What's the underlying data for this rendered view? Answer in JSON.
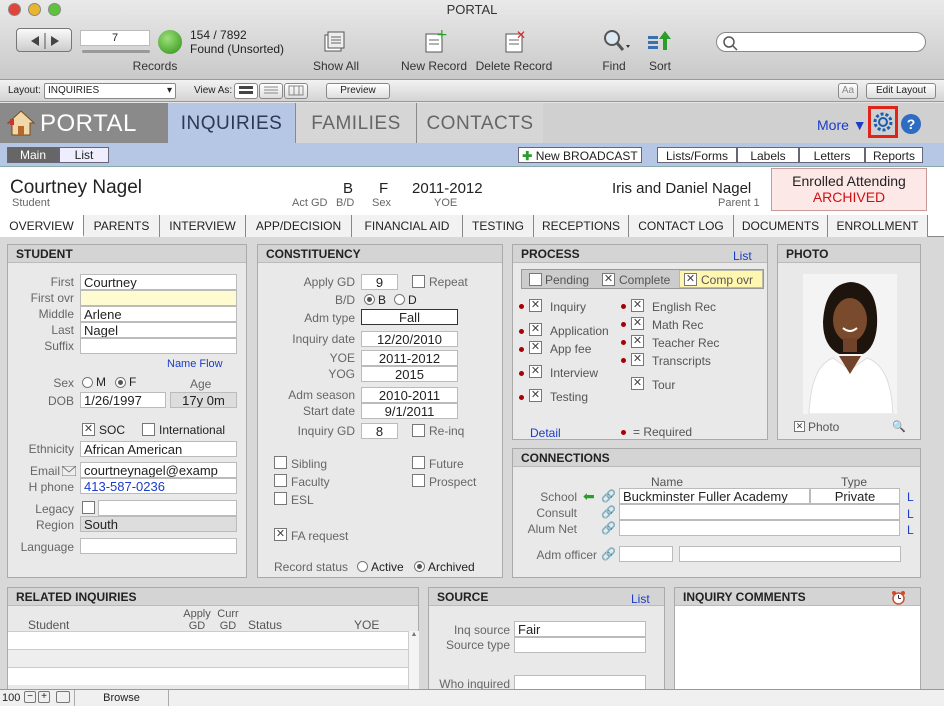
{
  "window": {
    "title": "PORTAL"
  },
  "toolbar": {
    "record_number": "7",
    "records_label": "Records",
    "count": "154 / 7892",
    "found": "Found (Unsorted)",
    "show_all": "Show All",
    "new_record": "New Record",
    "delete_record": "Delete Record",
    "find": "Find",
    "sort": "Sort"
  },
  "layoutbar": {
    "layout_label": "Layout:",
    "layout_value": "INQUIRIES",
    "view_as": "View As:",
    "preview": "Preview",
    "aa": "Aa",
    "edit_layout": "Edit Layout"
  },
  "nav": {
    "app": "PORTAL",
    "tabs": [
      "INQUIRIES",
      "FAMILIES",
      "CONTACTS"
    ],
    "more": "More"
  },
  "subbar": {
    "main": "Main",
    "list": "List",
    "new_broadcast": "New BROADCAST",
    "buttons": [
      "Lists/Forms",
      "Labels",
      "Letters",
      "Reports"
    ]
  },
  "person": {
    "name": "Courtney Nagel",
    "name_sub": "Student",
    "gd": "B",
    "gd_label": "Act GD",
    "bd_label": "B/D",
    "sex": "F",
    "sex_label": "Sex",
    "yoe": "2011-2012",
    "yoe_label": "YOE",
    "parents": "Iris and Daniel Nagel",
    "parent_label": "Parent 1",
    "status1": "Enrolled Attending",
    "status2": "ARCHIVED"
  },
  "tabs": [
    "OVERVIEW",
    "PARENTS",
    "INTERVIEW",
    "APP/DECISION",
    "FINANCIAL AID",
    "TESTING",
    "RECEPTIONS",
    "CONTACT LOG",
    "DOCUMENTS",
    "ENROLLMENT"
  ],
  "student": {
    "title": "STUDENT",
    "first_l": "First",
    "first": "Courtney",
    "firstovr_l": "First ovr",
    "middle_l": "Middle",
    "middle": "Arlene",
    "last_l": "Last",
    "last": "Nagel",
    "suffix_l": "Suffix",
    "name_flow": "Name Flow",
    "sex_l": "Sex",
    "m": "M",
    "f": "F",
    "age_l": "Age",
    "dob_l": "DOB",
    "dob": "1/26/1997",
    "age": "17y 0m",
    "soc": "SOC",
    "international": "International",
    "ethnicity_l": "Ethnicity",
    "ethnicity": "African American",
    "email_l": "Email",
    "email": "courtneynagel@examp",
    "hphone_l": "H phone",
    "hphone": "413-587-0236",
    "legacy_l": "Legacy",
    "region_l": "Region",
    "region": "South",
    "language_l": "Language"
  },
  "constituency": {
    "title": "CONSTITUENCY",
    "apply_gd_l": "Apply GD",
    "apply_gd": "9",
    "repeat": "Repeat",
    "bd_l": "B/D",
    "b": "B",
    "d": "D",
    "admtype_l": "Adm type",
    "admtype": "Fall",
    "inqdate_l": "Inquiry date",
    "inqdate": "12/20/2010",
    "yoe_l": "YOE",
    "yoe": "2011-2012",
    "yog_l": "YOG",
    "yog": "2015",
    "admseason_l": "Adm season",
    "admseason": "2010-2011",
    "start_l": "Start date",
    "start": "9/1/2011",
    "inqgd_l": "Inquiry GD",
    "inqgd": "8",
    "reinq": "Re-inq",
    "sibling": "Sibling",
    "future": "Future",
    "faculty": "Faculty",
    "prospect": "Prospect",
    "esl": "ESL",
    "fa_request": "FA request",
    "record_status_l": "Record status",
    "active": "Active",
    "archived": "Archived"
  },
  "process": {
    "title": "PROCESS",
    "list": "List",
    "pending": "Pending",
    "complete": "Complete",
    "comp_ovr": "Comp ovr",
    "left": [
      "Inquiry",
      "Application",
      "App fee",
      "Interview",
      "Testing"
    ],
    "right": [
      "English Rec",
      "Math Rec",
      "Teacher Rec",
      "Transcripts",
      "Tour"
    ],
    "detail": "Detail",
    "required": "= Required"
  },
  "photo": {
    "title": "PHOTO",
    "caption": "Photo"
  },
  "connections": {
    "title": "CONNECTIONS",
    "name_h": "Name",
    "type_h": "Type",
    "school_l": "School",
    "school": "Buckminster Fuller Academy",
    "school_type": "Private",
    "consult_l": "Consult",
    "alum_l": "Alum Net",
    "admofficer_l": "Adm officer",
    "l": "L"
  },
  "related": {
    "title": "RELATED INQUIRIES",
    "cols": [
      "Student",
      "Apply GD",
      "Curr GD",
      "Status",
      "YOE"
    ]
  },
  "source": {
    "title": "SOURCE",
    "list": "List",
    "inq_source_l": "Inq source",
    "inq_source": "Fair",
    "source_type_l": "Source type",
    "who_l": "Who inquired"
  },
  "comments": {
    "title": "INQUIRY COMMENTS"
  },
  "statusbar": {
    "zoom": "100",
    "mode": "Browse"
  }
}
